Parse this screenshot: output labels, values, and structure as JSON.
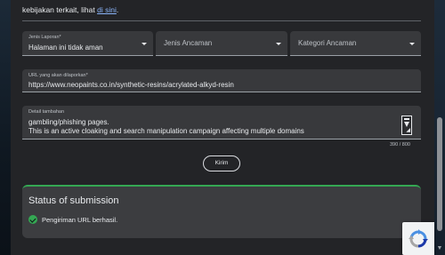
{
  "intro": {
    "text": "kebijakan terkait, lihat",
    "link": "di sini",
    "suffix": "."
  },
  "form": {
    "report_type": {
      "label": "Jenis Laporan*",
      "value": "Halaman ini tidak aman"
    },
    "threat_type": {
      "placeholder": "Jenis Ancaman"
    },
    "threat_category": {
      "placeholder": "Kategori Ancaman"
    },
    "url": {
      "label": "URL yang akan dilaporkan*",
      "value": "https://www.neopaints.co.in/synthetic-resins/acrylated-alkyd-resin"
    },
    "details": {
      "label": "Detail tambahan",
      "line1": "gambling/phishing pages.",
      "line2": "This is an active cloaking and search manipulation campaign affecting multiple domains",
      "counter": "390 / 800"
    },
    "submit_label": "Kirim"
  },
  "status": {
    "title": "Status of submission",
    "message": "Pengiriman URL berhasil."
  },
  "colors": {
    "accent_green": "#34a853",
    "link_blue": "#8ab4f8"
  }
}
